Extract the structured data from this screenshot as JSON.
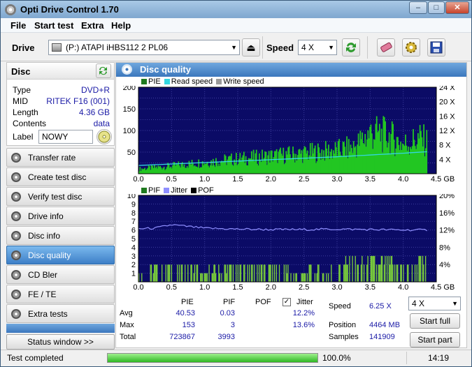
{
  "window": {
    "title": "Opti Drive Control 1.70",
    "buttons": [
      "–",
      "□",
      "✕"
    ]
  },
  "menu": [
    "File",
    "Start test",
    "Extra",
    "Help"
  ],
  "toolbar": {
    "drive_label": "Drive",
    "drive_value": "(P:)   ATAPI iHBS112   2 PL06",
    "speed_label": "Speed",
    "speed_value": "4 X"
  },
  "disc": {
    "header": "Disc",
    "rows": [
      {
        "key": "Type",
        "value": "DVD+R"
      },
      {
        "key": "MID",
        "value": "RITEK F16 (001)"
      },
      {
        "key": "Length",
        "value": "4.36 GB"
      },
      {
        "key": "Contents",
        "value": "data"
      }
    ],
    "label_key": "Label",
    "label_value": "NOWY"
  },
  "nav": [
    {
      "label": "Transfer rate",
      "active": false
    },
    {
      "label": "Create test disc",
      "active": false
    },
    {
      "label": "Verify test disc",
      "active": false
    },
    {
      "label": "Drive info",
      "active": false
    },
    {
      "label": "Disc info",
      "active": false
    },
    {
      "label": "Disc quality",
      "active": true
    },
    {
      "label": "CD Bler",
      "active": false
    },
    {
      "label": "FE / TE",
      "active": false
    },
    {
      "label": "Extra tests",
      "active": false
    }
  ],
  "status_window_button": "Status window >>",
  "panel_title": "Disc quality",
  "chart_data": [
    {
      "type": "area",
      "legend": [
        {
          "name": "PIE",
          "color": "#1f7a1f"
        },
        {
          "name": "Read speed",
          "color": "#33d7e0"
        },
        {
          "name": "Write speed",
          "color": "#9a9a9a"
        }
      ],
      "x_ticks": [
        "0.0",
        "0.5",
        "1.0",
        "1.5",
        "2.0",
        "2.5",
        "3.0",
        "3.5",
        "4.0",
        "4.5 GB"
      ],
      "y_ticks": [
        "200",
        "150",
        "100",
        "50"
      ],
      "y2_ticks": [
        "24 X",
        "20 X",
        "16 X",
        "12 X",
        "8 X",
        "4 X"
      ],
      "xlim": [
        0,
        4.5
      ],
      "ylim": [
        0,
        200
      ],
      "y2lim": [
        0,
        24
      ],
      "series": [
        {
          "name": "PIE",
          "x": [
            0.0,
            0.5,
            1.0,
            1.5,
            2.0,
            2.5,
            3.0,
            3.25,
            3.5,
            3.75,
            4.0,
            4.25,
            4.36
          ],
          "y": [
            12,
            20,
            30,
            38,
            45,
            52,
            60,
            68,
            105,
            98,
            75,
            90,
            80
          ]
        },
        {
          "name": "Read speed",
          "x": [
            0.0,
            0.5,
            1.0,
            1.5,
            2.0,
            2.5,
            3.0,
            3.5,
            4.0,
            4.36
          ],
          "y": [
            2.3,
            2.7,
            3.1,
            3.5,
            3.9,
            4.3,
            4.7,
            5.2,
            5.7,
            6.1
          ]
        }
      ],
      "grid": true
    },
    {
      "type": "bar",
      "legend": [
        {
          "name": "PIF",
          "color": "#1f7a1f"
        },
        {
          "name": "Jitter",
          "color": "#8f8fff"
        },
        {
          "name": "POF",
          "color": "#000000"
        }
      ],
      "x_ticks": [
        "0.0",
        "0.5",
        "1.0",
        "1.5",
        "2.0",
        "2.5",
        "3.0",
        "3.5",
        "4.0",
        "4.5 GB"
      ],
      "y_ticks": [
        "10",
        "9",
        "8",
        "7",
        "6",
        "5",
        "4",
        "3",
        "2",
        "1"
      ],
      "y2_ticks": [
        "20%",
        "16%",
        "12%",
        "8%",
        "4%"
      ],
      "xlim": [
        0,
        4.5
      ],
      "ylim": [
        0,
        10
      ],
      "y2lim": [
        0,
        20
      ],
      "series": [
        {
          "name": "PIF",
          "x": [
            0.0,
            0.5,
            1.0,
            1.5,
            2.0,
            2.5,
            3.0,
            3.5,
            4.0,
            4.36
          ],
          "y": [
            1,
            2,
            1,
            2,
            2,
            1,
            2,
            3,
            2,
            3
          ]
        },
        {
          "name": "Jitter",
          "x": [
            0.0,
            0.25,
            0.5,
            1.0,
            1.5,
            2.0,
            2.5,
            3.0,
            3.5,
            4.0,
            4.36
          ],
          "y": [
            12.3,
            12.4,
            13.2,
            12.4,
            12.2,
            12.1,
            12.1,
            12.2,
            12.1,
            12.0,
            12.0
          ]
        }
      ],
      "grid": true
    }
  ],
  "stats": {
    "headers": [
      "PIE",
      "PIF",
      "POF",
      "Jitter"
    ],
    "rows": [
      {
        "label": "Avg",
        "pie": "40.53",
        "pif": "0.03",
        "jitter": "12.2%"
      },
      {
        "label": "Max",
        "pie": "153",
        "pif": "3",
        "jitter": "13.6%"
      },
      {
        "label": "Total",
        "pie": "723867",
        "pif": "3993",
        "jitter": ""
      }
    ],
    "jitter_check": "✓",
    "speed_label": "Speed",
    "speed_value": "6.25 X",
    "position_label": "Position",
    "position_value": "4464 MB",
    "samples_label": "Samples",
    "samples_value": "141909",
    "speed_select": "4 X",
    "start_full": "Start full",
    "start_part": "Start part"
  },
  "statusbar": {
    "text": "Test completed",
    "progress": 100,
    "progress_text": "100.0%",
    "time": "14:19"
  }
}
